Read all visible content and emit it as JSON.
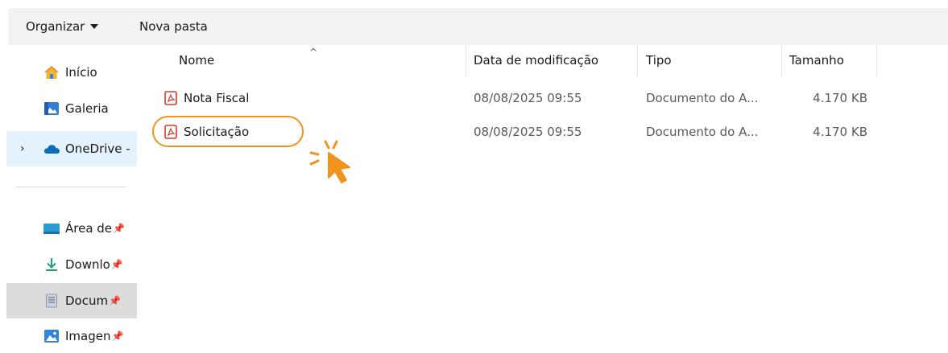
{
  "toolbar": {
    "organize_label": "Organizar",
    "new_folder_label": "Nova pasta"
  },
  "sidebar": {
    "items": [
      {
        "label": "Início",
        "icon": "home-icon"
      },
      {
        "label": "Galeria",
        "icon": "gallery-icon"
      },
      {
        "label": "OneDrive -",
        "icon": "onedrive-cloud-icon"
      },
      {
        "label": "Área de",
        "icon": "desktop-icon",
        "pinned": true
      },
      {
        "label": "Downlo",
        "icon": "download-arrow-icon",
        "pinned": true
      },
      {
        "label": "Docum",
        "icon": "documents-icon",
        "pinned": true
      },
      {
        "label": "Imagen",
        "icon": "pictures-icon",
        "pinned": true
      }
    ],
    "pin_glyph": "📌",
    "expand_glyph": "›"
  },
  "columns": {
    "name": "Nome",
    "modified": "Data de modificação",
    "type": "Tipo",
    "size": "Tamanho",
    "sort_glyph": "^"
  },
  "files": [
    {
      "name": "Nota Fiscal",
      "modified": "08/08/2025 09:55",
      "type": "Documento do A...",
      "size": "4.170 KB",
      "icon": "pdf-icon"
    },
    {
      "name": "Solicitação",
      "modified": "08/08/2025 09:55",
      "type": "Documento do A...",
      "size": "4.170 KB",
      "icon": "pdf-icon"
    }
  ],
  "colors": {
    "highlight": "#f0931f",
    "pdf_red": "#d83b2b",
    "selected_nav": "#e5f1fb"
  }
}
